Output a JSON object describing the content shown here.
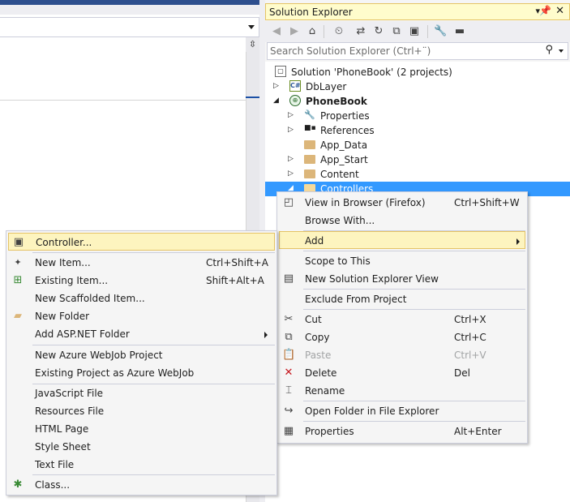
{
  "solution_explorer": {
    "title": "Solution Explorer",
    "pin_glyph": "▾",
    "search_placeholder": "Search Solution Explorer (Ctrl+¨)",
    "tree": {
      "solution": "Solution 'PhoneBook' (2 projects)",
      "project1": "DbLayer",
      "project2": "PhoneBook",
      "properties": "Properties",
      "references": "References",
      "app_data": "App_Data",
      "app_start": "App_Start",
      "content": "Content",
      "controllers": "Controllers"
    }
  },
  "project_menu": {
    "view_in_browser": {
      "label": "View in Browser (Firefox)",
      "shortcut": "Ctrl+Shift+W"
    },
    "browse_with": {
      "label": "Browse With..."
    },
    "add": {
      "label": "Add"
    },
    "scope_to_this": {
      "label": "Scope to This"
    },
    "new_se_view": {
      "label": "New Solution Explorer View"
    },
    "exclude": {
      "label": "Exclude From Project"
    },
    "cut": {
      "label": "Cut",
      "shortcut": "Ctrl+X"
    },
    "copy": {
      "label": "Copy",
      "shortcut": "Ctrl+C"
    },
    "paste": {
      "label": "Paste",
      "shortcut": "Ctrl+V"
    },
    "delete": {
      "label": "Delete",
      "shortcut": "Del"
    },
    "rename": {
      "label": "Rename"
    },
    "open_folder": {
      "label": "Open Folder in File Explorer"
    },
    "properties": {
      "label": "Properties",
      "shortcut": "Alt+Enter"
    }
  },
  "add_menu": {
    "controller": {
      "label": "Controller..."
    },
    "new_item": {
      "label": "New Item...",
      "shortcut": "Ctrl+Shift+A"
    },
    "existing_item": {
      "label": "Existing Item...",
      "shortcut": "Shift+Alt+A"
    },
    "new_scaffolded": {
      "label": "New Scaffolded Item..."
    },
    "new_folder": {
      "label": "New Folder"
    },
    "add_aspnet_folder": {
      "label": "Add ASP.NET Folder"
    },
    "new_azure_webjob": {
      "label": "New Azure WebJob Project"
    },
    "existing_as_webjob": {
      "label": "Existing Project as Azure WebJob"
    },
    "javascript_file": {
      "label": "JavaScript File"
    },
    "resources_file": {
      "label": "Resources File"
    },
    "html_page": {
      "label": "HTML Page"
    },
    "style_sheet": {
      "label": "Style Sheet"
    },
    "text_file": {
      "label": "Text File"
    },
    "class": {
      "label": "Class..."
    }
  },
  "colors": {
    "selection": "#3399ff",
    "highlight_bg": "#fdf4bf",
    "highlight_border": "#e5c365",
    "folder": "#dcb67a",
    "accent": "#2e4f8e"
  }
}
